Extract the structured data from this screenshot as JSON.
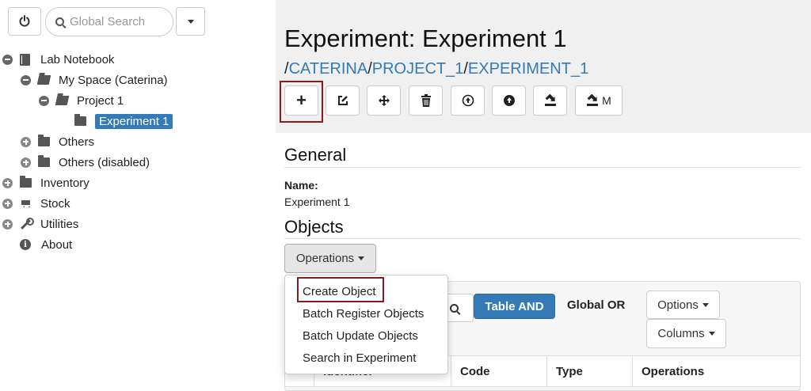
{
  "sidebar": {
    "search_placeholder": "Global Search",
    "tree": {
      "lab_notebook": "Lab Notebook",
      "my_space": "My Space (Caterina)",
      "project": "Project 1",
      "experiment": "Experiment 1",
      "others": "Others",
      "others_disabled": "Others (disabled)",
      "inventory": "Inventory",
      "stock": "Stock",
      "utilities": "Utilities",
      "about": "About"
    }
  },
  "main": {
    "title": "Experiment: Experiment 1",
    "breadcrumb": {
      "sep": "/",
      "space": "CATERINA",
      "project": "PROJECT_1",
      "experiment": "EXPERIMENT_1"
    },
    "toolbar": {
      "add": "+",
      "upload_m_label": "M"
    },
    "general": {
      "heading": "General",
      "name_label": "Name:",
      "name_value": "Experiment 1"
    },
    "objects": {
      "heading": "Objects",
      "operations_label": "Operations",
      "menu": [
        "Create Object",
        "Batch Register Objects",
        "Batch Update Objects",
        "Search in Experiment"
      ],
      "table_and": "Table AND",
      "global_or": "Global OR",
      "options_label": "Options",
      "columns_label": "Columns",
      "columns": [
        "Identifier",
        "Code",
        "Type",
        "Operations"
      ]
    }
  },
  "colors": {
    "accent": "#337ab7",
    "highlight_border": "#8b1a1a",
    "header_bg": "#f0f0f0"
  }
}
